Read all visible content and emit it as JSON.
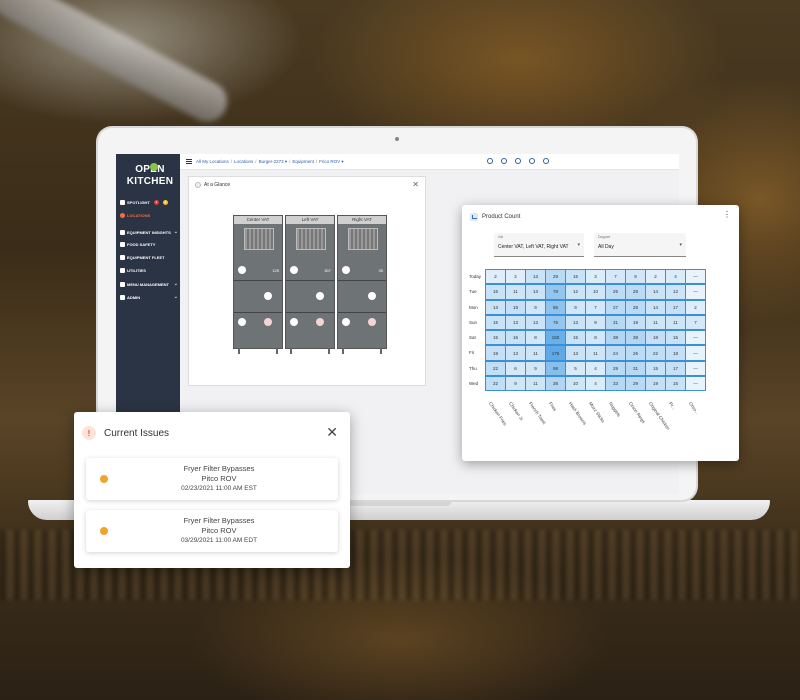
{
  "app": {
    "logo_line1": "OPEN",
    "logo_line2": "KITCHEN"
  },
  "sidebar": {
    "items": [
      {
        "label": "SPOTLIGHT",
        "active": false,
        "chevron": false
      },
      {
        "label": "LOCATIONS",
        "active": true,
        "chevron": false
      },
      {
        "label": "EQUIPMENT INSIGHTS",
        "active": false,
        "chevron": true
      },
      {
        "label": "FOOD SAFETY",
        "active": false,
        "chevron": false
      },
      {
        "label": "EQUIPMENT FLEET",
        "active": false,
        "chevron": false
      },
      {
        "label": "UTILITIES",
        "active": false,
        "chevron": false
      },
      {
        "label": "MENU MANAGEMENT",
        "active": false,
        "chevron": true
      },
      {
        "label": "ADMIN",
        "active": false,
        "chevron": true
      }
    ],
    "badges": [
      "1",
      "2"
    ],
    "badge_colors": [
      "#e53935",
      "#fbc02d"
    ]
  },
  "breadcrumb": {
    "items": [
      "All My Locations",
      "Locations",
      "Burger-2273 ▾",
      "Equipment",
      "Frico ROV ▾"
    ],
    "separator": "/"
  },
  "glance": {
    "title": "At a Glance",
    "close": "✕",
    "fryers": [
      {
        "label": "Center VAT",
        "count": "125"
      },
      {
        "label": "Left VAT",
        "count": "307"
      },
      {
        "label": "Right VAT",
        "count": "35"
      }
    ]
  },
  "product_count": {
    "title": "Product Count",
    "menu": "⋮",
    "vat_select": {
      "label": "Vat",
      "value": "Center VAT, Left VAT, Right VAT"
    },
    "daypart_select": {
      "label": "Daypart",
      "value": "All Day"
    },
    "rows": [
      "Today",
      "Tue",
      "Mon",
      "Sun",
      "Sat",
      "Fri",
      "Thu",
      "Wed"
    ],
    "columns": [
      "Chicken Fries",
      "Chicken Jr.",
      "French Toast",
      "Fries",
      "Hash Browns",
      "Mozz Sticks",
      "Nuggets",
      "Onion Rings",
      "Original Chicken",
      "Pr...",
      "Oreo..."
    ],
    "values": [
      [
        "2",
        "2",
        "13",
        "29",
        "15",
        "3",
        "7",
        "9",
        "2",
        "4",
        "—"
      ],
      [
        "15",
        "11",
        "13",
        "78",
        "12",
        "10",
        "25",
        "28",
        "14",
        "12",
        "—"
      ],
      [
        "13",
        "19",
        "9",
        "86",
        "9",
        "7",
        "27",
        "28",
        "14",
        "17",
        "2"
      ],
      [
        "15",
        "13",
        "13",
        "75",
        "13",
        "9",
        "31",
        "19",
        "11",
        "11",
        "7"
      ],
      [
        "15",
        "16",
        "8",
        "150",
        "15",
        "8",
        "38",
        "38",
        "18",
        "15",
        "—"
      ],
      [
        "19",
        "13",
        "11",
        "175",
        "13",
        "11",
        "24",
        "26",
        "22",
        "18",
        "—"
      ],
      [
        "22",
        "6",
        "9",
        "98",
        "5",
        "4",
        "29",
        "31",
        "15",
        "17",
        "—"
      ],
      [
        "22",
        "9",
        "11",
        "38",
        "10",
        "4",
        "33",
        "29",
        "19",
        "15",
        "—"
      ]
    ],
    "heat_low": "#e8f3fc",
    "heat_high": "#5ea9e6"
  },
  "issues": {
    "title": "Current Issues",
    "warn_icon": "!",
    "close": "✕",
    "list": [
      {
        "title": "Fryer Filter Bypasses",
        "device": "Pitco ROV",
        "time": "02/23/2021 11:00 AM EST"
      },
      {
        "title": "Fryer Filter Bypasses",
        "device": "Pitco ROV",
        "time": "03/29/2021 11:00 AM EDT"
      }
    ],
    "dot_color": "#f0a52a"
  }
}
